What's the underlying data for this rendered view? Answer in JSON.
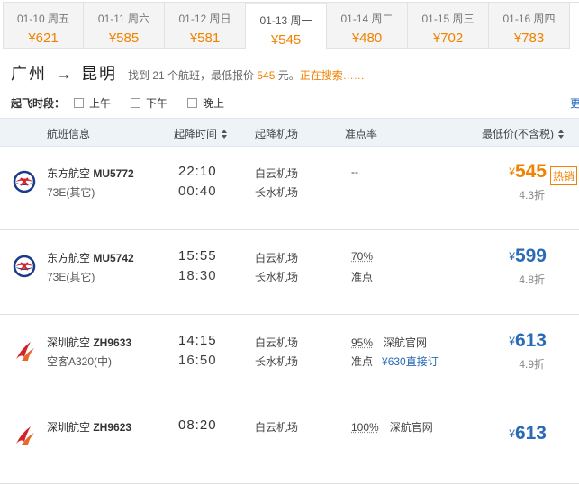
{
  "date_tabs": [
    {
      "date": "01-10 周五",
      "price": "¥621",
      "active": false
    },
    {
      "date": "01-11 周六",
      "price": "¥585",
      "active": false
    },
    {
      "date": "01-12 周日",
      "price": "¥581",
      "active": false
    },
    {
      "date": "01-13 周一",
      "price": "¥545",
      "active": true
    },
    {
      "date": "01-14 周二",
      "price": "¥480",
      "active": false
    },
    {
      "date": "01-15 周三",
      "price": "¥702",
      "active": false
    },
    {
      "date": "01-16 周四",
      "price": "¥783",
      "active": false
    }
  ],
  "route": {
    "from": "广州",
    "arrow": "→",
    "to": "昆明",
    "summary_pre": "找到 21 个航班，最低报价 ",
    "lowest": "545",
    "summary_post": " 元。",
    "searching": "正在搜索……"
  },
  "filter": {
    "label": "起飞时段：",
    "options": [
      "上午",
      "下午",
      "晚上"
    ],
    "more": "更多"
  },
  "header": {
    "flight": "航班信息",
    "time": "起降时间",
    "airport": "起降机场",
    "ontime": "准点率",
    "price": "最低价(不含税)"
  },
  "flights": [
    {
      "airline": "东方航空 ",
      "code": "MU5772",
      "model": "73E(其它)",
      "dep": "22:10",
      "arr": "00:40",
      "dep_airport": "白云机场",
      "arr_airport": "长水机场",
      "ontime": "--",
      "ontime_label": "",
      "official": "",
      "direct": "",
      "price_symbol": "¥",
      "price": "545",
      "discount": "4.3折",
      "badge": "热销",
      "logo": "china-eastern-logo-icon"
    },
    {
      "airline": "东方航空 ",
      "code": "MU5742",
      "model": "73E(其它)",
      "dep": "15:55",
      "arr": "18:30",
      "dep_airport": "白云机场",
      "arr_airport": "长水机场",
      "ontime": "70%",
      "ontime_label": "准点",
      "official": "",
      "direct": "",
      "price_symbol": "¥",
      "price": "599",
      "discount": "4.8折",
      "badge": "",
      "logo": "china-eastern-logo-icon"
    },
    {
      "airline": "深圳航空 ",
      "code": "ZH9633",
      "model": "空客A320(中)",
      "dep": "14:15",
      "arr": "16:50",
      "dep_airport": "白云机场",
      "arr_airport": "长水机场",
      "ontime": "95%",
      "ontime_label": "准点",
      "official": "深航官网",
      "direct": "¥630直接订",
      "price_symbol": "¥",
      "price": "613",
      "discount": "4.9折",
      "badge": "",
      "logo": "shenzhen-airlines-logo-icon"
    },
    {
      "airline": "深圳航空 ",
      "code": "ZH9623",
      "model": "",
      "dep": "08:20",
      "arr": "",
      "dep_airport": "白云机场",
      "arr_airport": "",
      "ontime": "100%",
      "ontime_label": "",
      "official": "深航官网",
      "direct": "",
      "price_symbol": "¥",
      "price": "613",
      "discount": "",
      "badge": "",
      "logo": "shenzhen-airlines-logo-icon"
    }
  ],
  "colors": {
    "accent": "#f08200",
    "link": "#2a6bb7",
    "header_bg": "#eef3f8"
  }
}
